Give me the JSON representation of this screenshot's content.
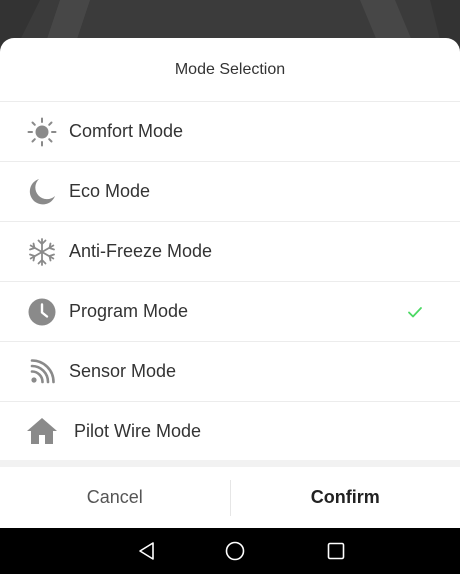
{
  "dialog": {
    "title": "Mode Selection"
  },
  "modes": [
    {
      "label": "Comfort Mode",
      "icon": "sun-icon",
      "selected": false
    },
    {
      "label": "Eco Mode",
      "icon": "moon-icon",
      "selected": false
    },
    {
      "label": "Anti-Freeze Mode",
      "icon": "snowflake-icon",
      "selected": false
    },
    {
      "label": "Program Mode",
      "icon": "clock-icon",
      "selected": true
    },
    {
      "label": "Sensor Mode",
      "icon": "sensor-signal-icon",
      "selected": false
    },
    {
      "label": "Pilot Wire Mode",
      "icon": "house-icon",
      "selected": false
    }
  ],
  "actions": {
    "cancel_label": "Cancel",
    "confirm_label": "Confirm"
  },
  "navigation": {
    "back_icon": "back-triangle-icon",
    "home_icon": "home-circle-icon",
    "recents_icon": "recents-square-icon"
  },
  "colors": {
    "icon_gray": "#8a8a8a",
    "check_green": "#4cd964",
    "text": "#333333",
    "navbar": "#000000"
  }
}
